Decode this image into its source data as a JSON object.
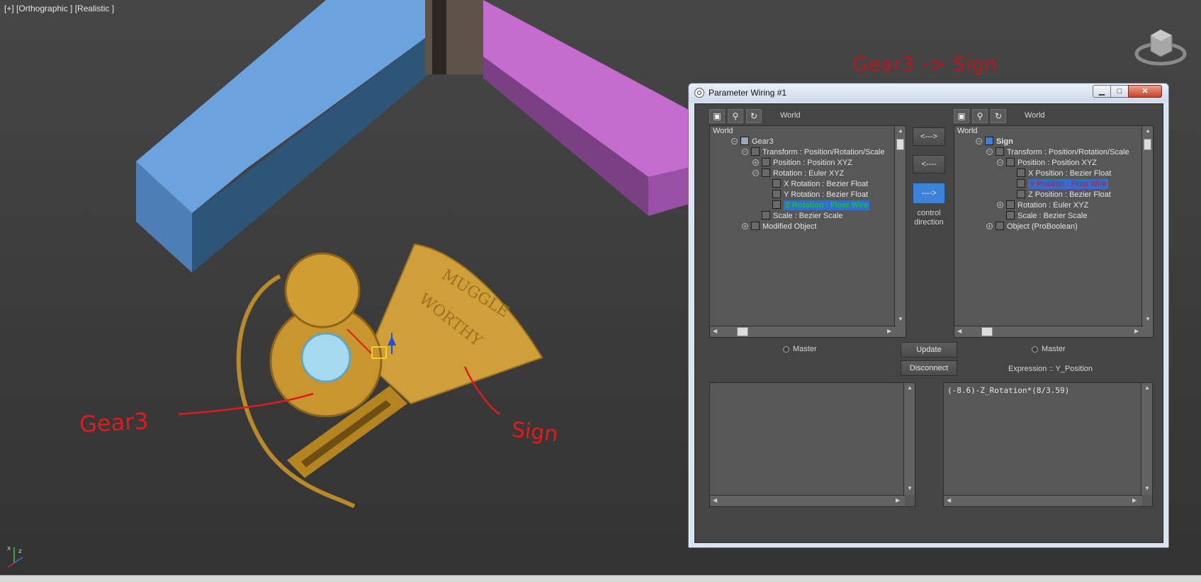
{
  "viewport": {
    "label": "[+] [Orthographic ] [Realistic ]",
    "annotations": {
      "gear": "Gear3",
      "sign": "Sign",
      "title": "Gear3 -> Sign"
    },
    "sign_text": [
      "MUGGLE",
      "WORTHY"
    ],
    "axis_labels": {
      "x": "x",
      "z": "z"
    }
  },
  "dialog": {
    "title": "Parameter Wiring #1",
    "window_buttons": {
      "minimize": "▁",
      "maximize": "□",
      "close": "✕"
    },
    "left_panel": {
      "toolbar_label": "World",
      "tree": [
        {
          "label": "World"
        },
        {
          "label": "Gear3"
        },
        {
          "label": "Transform : Position/Rotation/Scale"
        },
        {
          "label": "Position : Position XYZ"
        },
        {
          "label": "Rotation : Euler XYZ"
        },
        {
          "label": "X Rotation : Bezier Float"
        },
        {
          "label": "Y Rotation : Bezier Float"
        },
        {
          "label": "Z Rotation : Float Wire"
        },
        {
          "label": "Scale : Bezier Scale"
        },
        {
          "label": "Modified Object"
        }
      ],
      "master_label": "Master"
    },
    "right_panel": {
      "toolbar_label": "World",
      "tree": [
        {
          "label": "World"
        },
        {
          "label": "Sign"
        },
        {
          "label": "Transform : Position/Rotation/Scale"
        },
        {
          "label": "Position : Position XYZ"
        },
        {
          "label": "X Position : Bezier Float"
        },
        {
          "label": "Y Position : Float Wire"
        },
        {
          "label": "Z Position : Bezier Float"
        },
        {
          "label": "Rotation : Euler XYZ"
        },
        {
          "label": "Scale : Bezier Scale"
        },
        {
          "label": "Object (ProBoolean)"
        }
      ],
      "master_label": "Master",
      "expression_label": "Expression :: Y_Position"
    },
    "direction_buttons": {
      "both": "<--->",
      "left": "<----",
      "right": "---->",
      "caption": "control direction"
    },
    "update_button": "Update",
    "disconnect_button": "Disconnect",
    "left_expression": "",
    "right_expression": "(-8.6)-Z_Rotation*(8/3.59)"
  },
  "colors": {
    "annotation": "#e11b1b",
    "selection": "#2f6fd1",
    "left_block": "#5e9ad6",
    "right_block": "#c76ad3",
    "gold": "#c9952e"
  }
}
